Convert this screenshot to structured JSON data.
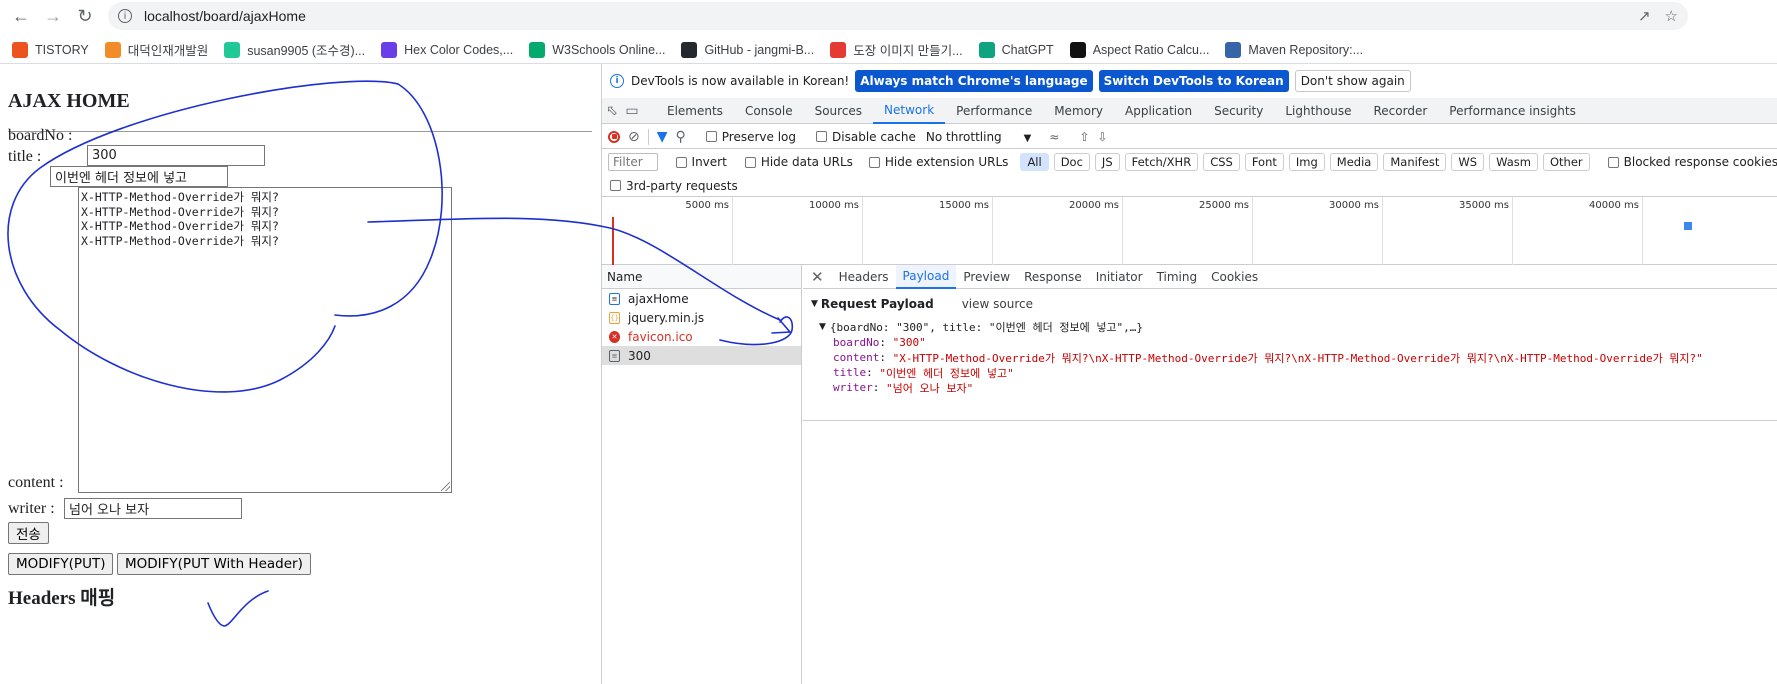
{
  "browser": {
    "url": "localhost/board/ajaxHome",
    "bookmarks": [
      {
        "label": "TISTORY",
        "icon": "tistory-icon",
        "color": "#eb531f"
      },
      {
        "label": "대덕인재개발원",
        "icon": "ddit-icon",
        "color": "#f28c28"
      },
      {
        "label": "susan9905 (조수경)...",
        "icon": "velog-icon",
        "color": "#20c997"
      },
      {
        "label": "Hex Color Codes,...",
        "icon": "colors-icon",
        "color": "#6a3de8"
      },
      {
        "label": "W3Schools Online...",
        "icon": "w3schools-icon",
        "color": "#04aa6d"
      },
      {
        "label": "GitHub - jangmi-B...",
        "icon": "github-icon",
        "color": "#24292f"
      },
      {
        "label": "도장 이미지 만들기...",
        "icon": "stamp-icon",
        "color": "#e53935"
      },
      {
        "label": "ChatGPT",
        "icon": "chatgpt-icon",
        "color": "#10a37f"
      },
      {
        "label": "Aspect Ratio Calcu...",
        "icon": "aspect-ratio-icon",
        "color": "#111111"
      },
      {
        "label": "Maven Repository:...",
        "icon": "maven-icon",
        "color": "#3565a8"
      }
    ]
  },
  "page": {
    "title": "AJAX HOME",
    "board_no_label": "boardNo :",
    "board_no_value": "300",
    "title_label": "title :",
    "title_value": "이번엔 헤더 정보에 넣고",
    "content_label": "content :",
    "content_lines": [
      "X-HTTP-Method-Override가 뭐지?",
      "X-HTTP-Method-Override가 뭐지?",
      "X-HTTP-Method-Override가 뭐지?",
      "X-HTTP-Method-Override가 뭐지?"
    ],
    "writer_label": "writer :",
    "writer_value": "넘어 오나 보자",
    "submit_label": "전송",
    "headers_title": "Headers 매핑",
    "modify_put_label": "MODIFY(PUT)",
    "modify_put_header_label": "MODIFY(PUT With Header)"
  },
  "devtools": {
    "infobar_text": "DevTools is now available in Korean!",
    "match_language_label": "Always match Chrome's language",
    "switch_korean_label": "Switch DevTools to Korean",
    "dont_show_label": "Don't show again",
    "tabs": [
      "Elements",
      "Console",
      "Sources",
      "Network",
      "Performance",
      "Memory",
      "Application",
      "Security",
      "Lighthouse",
      "Recorder",
      "Performance insights"
    ],
    "active_tab": "Network",
    "preserve_log": "Preserve log",
    "disable_cache": "Disable cache",
    "throttling": "No throttling",
    "filter_placeholder": "Filter",
    "invert": "Invert",
    "hide_data_urls": "Hide data URLs",
    "hide_extension_urls": "Hide extension URLs",
    "type_filters": [
      "All",
      "Doc",
      "JS",
      "Fetch/XHR",
      "CSS",
      "Font",
      "Img",
      "Media",
      "Manifest",
      "WS",
      "Wasm",
      "Other"
    ],
    "blocked_response_cookies": "Blocked response cookies",
    "third_party": "3rd-party requests",
    "timeline_ticks": [
      "5000 ms",
      "10000 ms",
      "15000 ms",
      "20000 ms",
      "25000 ms",
      "30000 ms",
      "35000 ms",
      "40000 ms"
    ],
    "name_column": "Name",
    "requests": [
      {
        "name": "ajaxHome",
        "type": "doc",
        "state": "normal"
      },
      {
        "name": "jquery.min.js",
        "type": "js",
        "state": "normal"
      },
      {
        "name": "favicon.ico",
        "type": "error",
        "state": "error"
      },
      {
        "name": "300",
        "type": "doc",
        "state": "selected"
      }
    ],
    "detail_tabs": [
      "Headers",
      "Payload",
      "Preview",
      "Response",
      "Initiator",
      "Timing",
      "Cookies"
    ],
    "active_detail_tab": "Payload",
    "payload_title": "Request Payload",
    "view_source": "view source",
    "payload_summary": "{boardNo: \"300\", title: \"이번엔 헤더 정보에 넣고\",…}",
    "payload_fields": [
      {
        "key": "boardNo",
        "value": "\"300\""
      },
      {
        "key": "content",
        "value": "\"X-HTTP-Method-Override가 뭐지?\\nX-HTTP-Method-Override가 뭐지?\\nX-HTTP-Method-Override가 뭐지?\\nX-HTTP-Method-Override가 뭐지?\""
      },
      {
        "key": "title",
        "value": "\"이번엔 헤더 정보에 넣고\""
      },
      {
        "key": "writer",
        "value": "\"넘어 오나 보자\""
      }
    ]
  },
  "colors": {
    "annotation_ink": "#1d2fd0",
    "devtools_accent": "#1a73e8",
    "error_red": "#d93025"
  }
}
